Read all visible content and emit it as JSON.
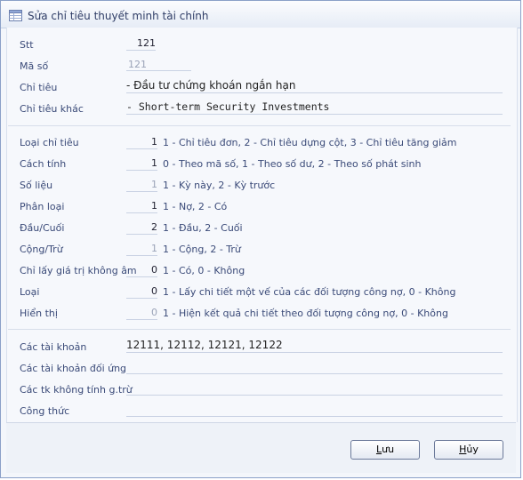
{
  "window": {
    "title": "Sửa chỉ tiêu thuyết minh tài chính",
    "icon": "form-table-icon"
  },
  "fields": {
    "stt": {
      "label": "Stt",
      "value": "121"
    },
    "ma_so": {
      "label": "Mã số",
      "value": "121"
    },
    "chi_tieu": {
      "label": "Chỉ tiêu",
      "value": "- Đầu tư chứng khoán ngắn hạn"
    },
    "chi_tieu_khac": {
      "label": "Chỉ tiêu khác",
      "value": "- Short-term Security Investments"
    }
  },
  "options": [
    {
      "key": "loai_chi_tieu",
      "label": "Loại chỉ tiêu",
      "value": "1",
      "desc": "1 - Chỉ tiêu đơn, 2 - Chỉ tiêu dựng cột, 3 - Chỉ tiêu tăng giảm",
      "muted": false
    },
    {
      "key": "cach_tinh",
      "label": "Cách tính",
      "value": "1",
      "desc": "0 - Theo mã số, 1 - Theo số dư, 2 - Theo số phát sinh",
      "muted": false
    },
    {
      "key": "so_lieu",
      "label": "Số liệu",
      "value": "1",
      "desc": "1 - Kỳ này, 2 - Kỳ trước",
      "muted": true
    },
    {
      "key": "phan_loai",
      "label": "Phân loại",
      "value": "1",
      "desc": "1 - Nợ, 2 - Có",
      "muted": false
    },
    {
      "key": "dau_cuoi",
      "label": "Đầu/Cuối",
      "value": "2",
      "desc": "1 - Đầu, 2 - Cuối",
      "muted": false
    },
    {
      "key": "cong_tru",
      "label": "Cộng/Trừ",
      "value": "1",
      "desc": "1 - Cộng, 2 - Trừ",
      "muted": true
    },
    {
      "key": "chi_lay_gia_tri_khong_am",
      "label": "Chỉ lấy giá trị không âm",
      "value": "0",
      "desc": "1 - Có, 0 - Không",
      "muted": false
    },
    {
      "key": "loai",
      "label": "Loại",
      "value": "0",
      "desc": "1 - Lấy chi tiết một vế của các đối tượng công nợ, 0 - Không",
      "muted": false
    },
    {
      "key": "hien_thi",
      "label": "Hiển thị",
      "value": "0",
      "desc": "1 - Hiện kết quả chi tiết theo đối tượng công nợ, 0 - Không",
      "muted": true
    }
  ],
  "accounts": {
    "cac_tai_khoan": {
      "label": "Các tài khoản",
      "value": "12111, 12112, 12121, 12122"
    },
    "cac_tai_khoan_doi_ung": {
      "label": "Các tài khoản đối ứng",
      "value": ""
    },
    "cac_tk_khong_tinh": {
      "label": "Các tk không tính g.trừ",
      "value": ""
    },
    "cong_thuc": {
      "label": "Công thức",
      "value": ""
    }
  },
  "buttons": {
    "save": {
      "pre": "",
      "mnemonic": "L",
      "post": "ưu"
    },
    "cancel": {
      "pre": "",
      "mnemonic": "H",
      "post": "ủy"
    }
  }
}
